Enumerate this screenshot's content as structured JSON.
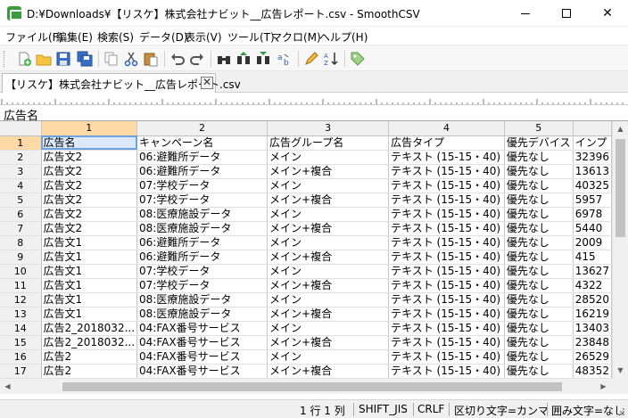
{
  "window": {
    "title": "D:¥Downloads¥【リスケ】株式会社ナビット__広告レポート.csv - SmoothCSV"
  },
  "menu": [
    "ファイル(F)",
    "編集(E)",
    "検索(S)",
    "データ(D)",
    "表示(V)",
    "ツール(T)",
    "マクロ(M)",
    "ヘルプ(H)"
  ],
  "toolbar_icons": [
    "new-file-icon",
    "open-folder-icon",
    "save-icon",
    "save-all-icon",
    "copy-icon",
    "cut-icon",
    "paste-icon",
    "undo-icon",
    "redo-icon",
    "find-icon",
    "find-prev-icon",
    "find-next-icon",
    "replace-icon",
    "edit-icon",
    "sort-icon",
    "tag-icon"
  ],
  "tab": {
    "label": "【リスケ】株式会社ナビット__広告レポート.csv"
  },
  "cell_view": {
    "value": "広告名"
  },
  "grid": {
    "column_numbers": [
      "1",
      "2",
      "3",
      "4",
      "5",
      ""
    ],
    "rows": [
      [
        "1",
        "広告名",
        "キャンペーン名",
        "広告グループ名",
        "広告タイプ",
        "優先デバイス",
        "インプ"
      ],
      [
        "2",
        "広告文2",
        "06:避難所データ",
        "メイン",
        "テキスト (15-15・40)",
        "優先なし",
        "32396"
      ],
      [
        "3",
        "広告文2",
        "06:避難所データ",
        "メイン+複合",
        "テキスト (15-15・40)",
        "優先なし",
        "13613"
      ],
      [
        "4",
        "広告文2",
        "07:学校データ",
        "メイン",
        "テキスト (15-15・40)",
        "優先なし",
        "40325"
      ],
      [
        "5",
        "広告文2",
        "07:学校データ",
        "メイン+複合",
        "テキスト (15-15・40)",
        "優先なし",
        "5957"
      ],
      [
        "6",
        "広告文2",
        "08:医療施設データ",
        "メイン",
        "テキスト (15-15・40)",
        "優先なし",
        "6978"
      ],
      [
        "7",
        "広告文2",
        "08:医療施設データ",
        "メイン+複合",
        "テキスト (15-15・40)",
        "優先なし",
        "5440"
      ],
      [
        "8",
        "広告文1",
        "06:避難所データ",
        "メイン",
        "テキスト (15-15・40)",
        "優先なし",
        "2009"
      ],
      [
        "9",
        "広告文1",
        "06:避難所データ",
        "メイン+複合",
        "テキスト (15-15・40)",
        "優先なし",
        "415"
      ],
      [
        "10",
        "広告文1",
        "07:学校データ",
        "メイン",
        "テキスト (15-15・40)",
        "優先なし",
        "13627"
      ],
      [
        "11",
        "広告文1",
        "07:学校データ",
        "メイン+複合",
        "テキスト (15-15・40)",
        "優先なし",
        "4322"
      ],
      [
        "12",
        "広告文1",
        "08:医療施設データ",
        "メイン",
        "テキスト (15-15・40)",
        "優先なし",
        "28520"
      ],
      [
        "13",
        "広告文1",
        "08:医療施設データ",
        "メイン+複合",
        "テキスト (15-15・40)",
        "優先なし",
        "16219"
      ],
      [
        "14",
        "広告2_2018032...",
        "04:FAX番号サービス",
        "メイン",
        "テキスト (15-15・40)",
        "優先なし",
        "13403"
      ],
      [
        "15",
        "広告2_2018032...",
        "04:FAX番号サービス",
        "メイン+複合",
        "テキスト (15-15・40)",
        "優先なし",
        "23848"
      ],
      [
        "16",
        "広告2",
        "04:FAX番号サービス",
        "メイン",
        "テキスト (15-15・40)",
        "優先なし",
        "26529"
      ],
      [
        "17",
        "広告2",
        "04:FAX番号サービス",
        "メイン+複合",
        "テキスト (15-15・40)",
        "優先なし",
        "48352"
      ],
      [
        "18",
        "広告2",
        "05:ポイ活・学",
        "メイン",
        "テキスト (15-15・40)",
        "優先なし",
        "10295"
      ]
    ]
  },
  "status": {
    "position": "1 行 1 列",
    "encoding": "SHIFT_JIS",
    "line_ending": "CRLF",
    "delimiter": "区切り文字=カンマ",
    "quote": "囲み文字=なし"
  }
}
